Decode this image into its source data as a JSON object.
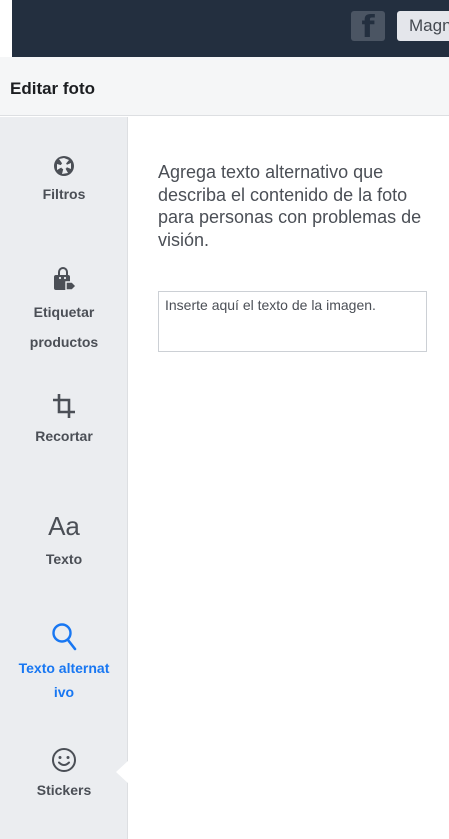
{
  "topbar": {
    "facebook_glyph": "f",
    "partial_label": "Magn"
  },
  "header": {
    "title": "Editar foto"
  },
  "sidebar": {
    "items": [
      {
        "id": "filtros",
        "label": "Filtros",
        "icon": "aperture-icon",
        "active": false
      },
      {
        "id": "etiquetar",
        "label": "Etiquetar productos",
        "icon": "shopping-bag-tag-icon",
        "active": false
      },
      {
        "id": "recortar",
        "label": "Recortar",
        "icon": "crop-icon",
        "active": false
      },
      {
        "id": "texto",
        "label": "Texto",
        "icon": "text-aa-icon",
        "icon_text": "Aa",
        "active": false
      },
      {
        "id": "alt",
        "label": "Texto alternativo",
        "icon": "search-icon",
        "active": true
      },
      {
        "id": "stickers",
        "label": "Stickers",
        "icon": "smiley-icon",
        "active": false
      }
    ]
  },
  "main": {
    "description": "Agrega texto alternativo que describa el contenido de la foto para personas con problemas de visión.",
    "alt_input": {
      "placeholder": "Inserte aquí el texto de la imagen.",
      "value": ""
    }
  },
  "colors": {
    "topbar_bg": "#232f3f",
    "sidebar_bg": "#ebedf0",
    "active_accent": "#1877f2",
    "icon_gray": "#4b4f56"
  }
}
